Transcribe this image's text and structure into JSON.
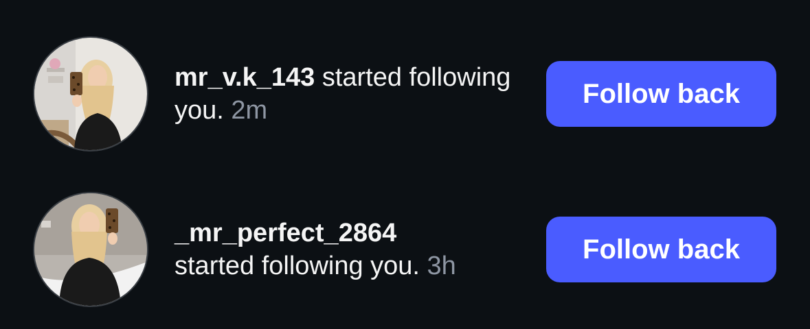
{
  "notifications": [
    {
      "username": "mr_v.k_143",
      "message": "started following you.",
      "time": "2m",
      "button_label": "Follow back"
    },
    {
      "username": "_mr_perfect_2864",
      "message": "started following you.",
      "time": "3h",
      "button_label": "Follow back"
    }
  ],
  "colors": {
    "background": "#0c1014",
    "button": "#4a5cff",
    "text": "#f5f5f5",
    "muted": "#8e96a3"
  }
}
